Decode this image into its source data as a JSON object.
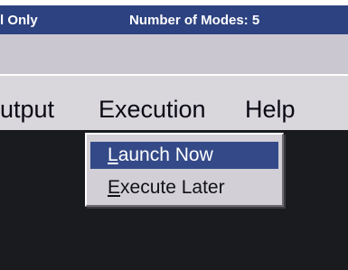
{
  "title_bar": {
    "left_text": "l Only",
    "right_text": "Number of Modes: 5"
  },
  "menu": {
    "items": [
      {
        "label": "utput"
      },
      {
        "label": "Execution"
      },
      {
        "label": "Help"
      }
    ]
  },
  "dropdown": {
    "items": [
      {
        "mnemonic": "L",
        "rest": "aunch Now",
        "selected": true
      },
      {
        "mnemonic": "E",
        "rest": "xecute Later",
        "selected": false
      }
    ]
  },
  "colors": {
    "title_bar_bg": "#2d4280",
    "selection_bg": "#344a88",
    "menu_bg": "#d9d6dc",
    "workspace_bg": "#1a1b1e"
  }
}
